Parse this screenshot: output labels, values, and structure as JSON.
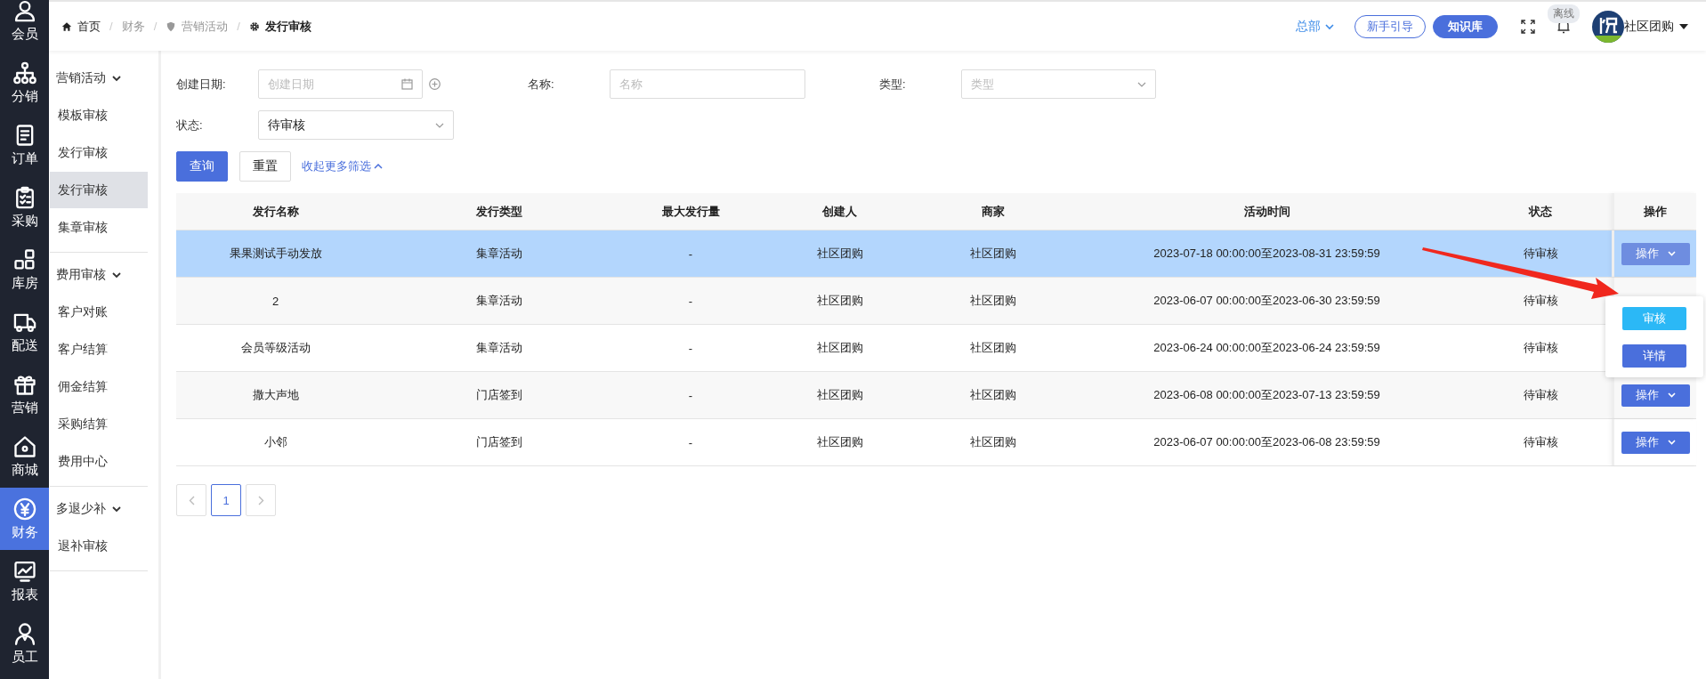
{
  "rail": [
    {
      "label": "会员",
      "kind": "user",
      "selected": false
    },
    {
      "label": "分销",
      "kind": "org",
      "selected": false
    },
    {
      "label": "订单",
      "kind": "doc",
      "selected": false
    },
    {
      "label": "采购",
      "kind": "clipboard",
      "selected": false
    },
    {
      "label": "库房",
      "kind": "boxes",
      "selected": false
    },
    {
      "label": "配送",
      "kind": "truck",
      "selected": false
    },
    {
      "label": "营销",
      "kind": "gift",
      "selected": false
    },
    {
      "label": "商城",
      "kind": "house",
      "selected": false
    },
    {
      "label": "财务",
      "kind": "yen",
      "selected": true
    },
    {
      "label": "报表",
      "kind": "chart",
      "selected": false
    },
    {
      "label": "员工",
      "kind": "staff",
      "selected": false
    }
  ],
  "menu": [
    {
      "label": "营销活动",
      "expanded": true,
      "children": [
        {
          "label": "模板审核",
          "selected": false
        },
        {
          "label": "发行审核",
          "selected": false
        },
        {
          "label": "发行审核",
          "selected": true
        },
        {
          "label": "集章审核",
          "selected": false
        }
      ]
    },
    {
      "label": "费用审核",
      "expanded": true,
      "children": [
        {
          "label": "客户对账",
          "selected": false
        },
        {
          "label": "客户结算",
          "selected": false
        },
        {
          "label": "佣金结算",
          "selected": false
        },
        {
          "label": "采购结算",
          "selected": false
        },
        {
          "label": "费用中心",
          "selected": false
        }
      ]
    },
    {
      "label": "多退少补",
      "expanded": true,
      "children": [
        {
          "label": "退补审核",
          "selected": false
        }
      ]
    }
  ],
  "breadcrumb": [
    {
      "label": "首页",
      "kind": "home",
      "separator": "/"
    },
    {
      "label": "财务",
      "separator": "/"
    },
    {
      "label": "营销活动",
      "kind": "shield",
      "separator": "/"
    },
    {
      "label": "发行审核",
      "kind": "gear"
    }
  ],
  "header": {
    "org": "总部",
    "guide_button": "新手引导",
    "kb_button": "知识库",
    "status_badge": "离线",
    "user": "社区团购"
  },
  "filters": {
    "date": {
      "label": "创建日期:",
      "placeholder": "创建日期"
    },
    "name": {
      "label": "名称:",
      "placeholder": "名称"
    },
    "type": {
      "label": "类型:",
      "placeholder": "类型"
    },
    "status": {
      "label": "状态:",
      "value": "待审核"
    },
    "search_button": "查询",
    "reset_button": "重置",
    "collapse_link": "收起更多筛选"
  },
  "table": {
    "columns": [
      "发行名称",
      "发行类型",
      "最大发行量",
      "创建人",
      "商家",
      "活动时间",
      "状态",
      "操作"
    ],
    "rows": [
      {
        "cells": [
          "果果测试手动发放",
          "集章活动",
          "-",
          "社区团购",
          "社区团购",
          "2023-07-18 00:00:00至2023-08-31 23:59:59",
          "待审核"
        ],
        "selected": true,
        "action": "操作",
        "open": true
      },
      {
        "cells": [
          "2",
          "集章活动",
          "-",
          "社区团购",
          "社区团购",
          "2023-06-07 00:00:00至2023-06-30 23:59:59",
          "待审核"
        ],
        "selected": false
      },
      {
        "cells": [
          "会员等级活动",
          "集章活动",
          "-",
          "社区团购",
          "社区团购",
          "2023-06-24 00:00:00至2023-06-24 23:59:59",
          "待审核"
        ],
        "selected": false
      },
      {
        "cells": [
          "撒大声地",
          "门店签到",
          "-",
          "社区团购",
          "社区团购",
          "2023-06-08 00:00:00至2023-07-13 23:59:59",
          "待审核"
        ],
        "selected": false,
        "action": "操作",
        "open": false
      },
      {
        "cells": [
          "小邻",
          "门店签到",
          "-",
          "社区团购",
          "社区团购",
          "2023-06-07 00:00:00至2023-06-08 23:59:59",
          "待审核"
        ],
        "selected": false,
        "action": "操作",
        "open": false
      }
    ]
  },
  "dropdown": {
    "items": [
      {
        "label": "审核",
        "color": "#2bb8f6"
      },
      {
        "label": "详情",
        "color": "#4a6fdc"
      }
    ]
  },
  "pagination": {
    "pages": [
      {
        "label": "1",
        "selected": true
      }
    ]
  }
}
